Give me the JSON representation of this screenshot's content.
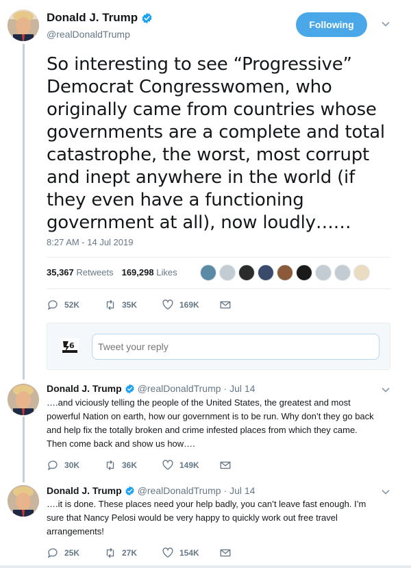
{
  "main_tweet": {
    "name": "Donald J. Trump",
    "handle": "@realDonaldTrump",
    "follow_label": "Following",
    "text": "So interesting to see “Progressive” Democrat Congresswomen, who originally came from countries whose governments are a complete and total catastrophe, the worst, most corrupt and inept anywhere in the world (if they even have a functioning government at all), now loudly……",
    "timestamp": "8:27 AM - 14 Jul 2019",
    "retweets_count": "35,367",
    "retweets_label": "Retweets",
    "likes_count": "169,298",
    "likes_label": "Likes",
    "actions": {
      "replies": "52K",
      "retweets": "35K",
      "likes": "169K"
    }
  },
  "reply_box": {
    "placeholder": "Tweet your reply"
  },
  "replies": [
    {
      "name": "Donald J. Trump",
      "handle": "@realDonaldTrump",
      "date": "· Jul 14",
      "text": "….and viciously telling the people of the United States, the greatest and most powerful Nation on earth, how our government is to be run. Why don’t they go back and help fix the totally broken and crime infested places from which they came. Then come back and show us how….",
      "actions": {
        "replies": "30K",
        "retweets": "36K",
        "likes": "149K"
      }
    },
    {
      "name": "Donald J. Trump",
      "handle": "@realDonaldTrump",
      "date": "· Jul 14",
      "text": "….it is done. These places need your help badly, you can’t leave fast enough. I’m sure that Nancy Pelosi would be very happy to quickly work out free travel arrangements!",
      "actions": {
        "replies": "25K",
        "retweets": "27K",
        "likes": "154K"
      }
    }
  ],
  "colors": {
    "accent": "#1da1f2",
    "follow_button": "#4aa7e8",
    "secondary_text": "#657786",
    "thread_line": "#c4d1db"
  },
  "icons": [
    "verified-icon",
    "chevron-down-icon",
    "reply-icon",
    "retweet-icon",
    "like-icon",
    "message-icon"
  ]
}
